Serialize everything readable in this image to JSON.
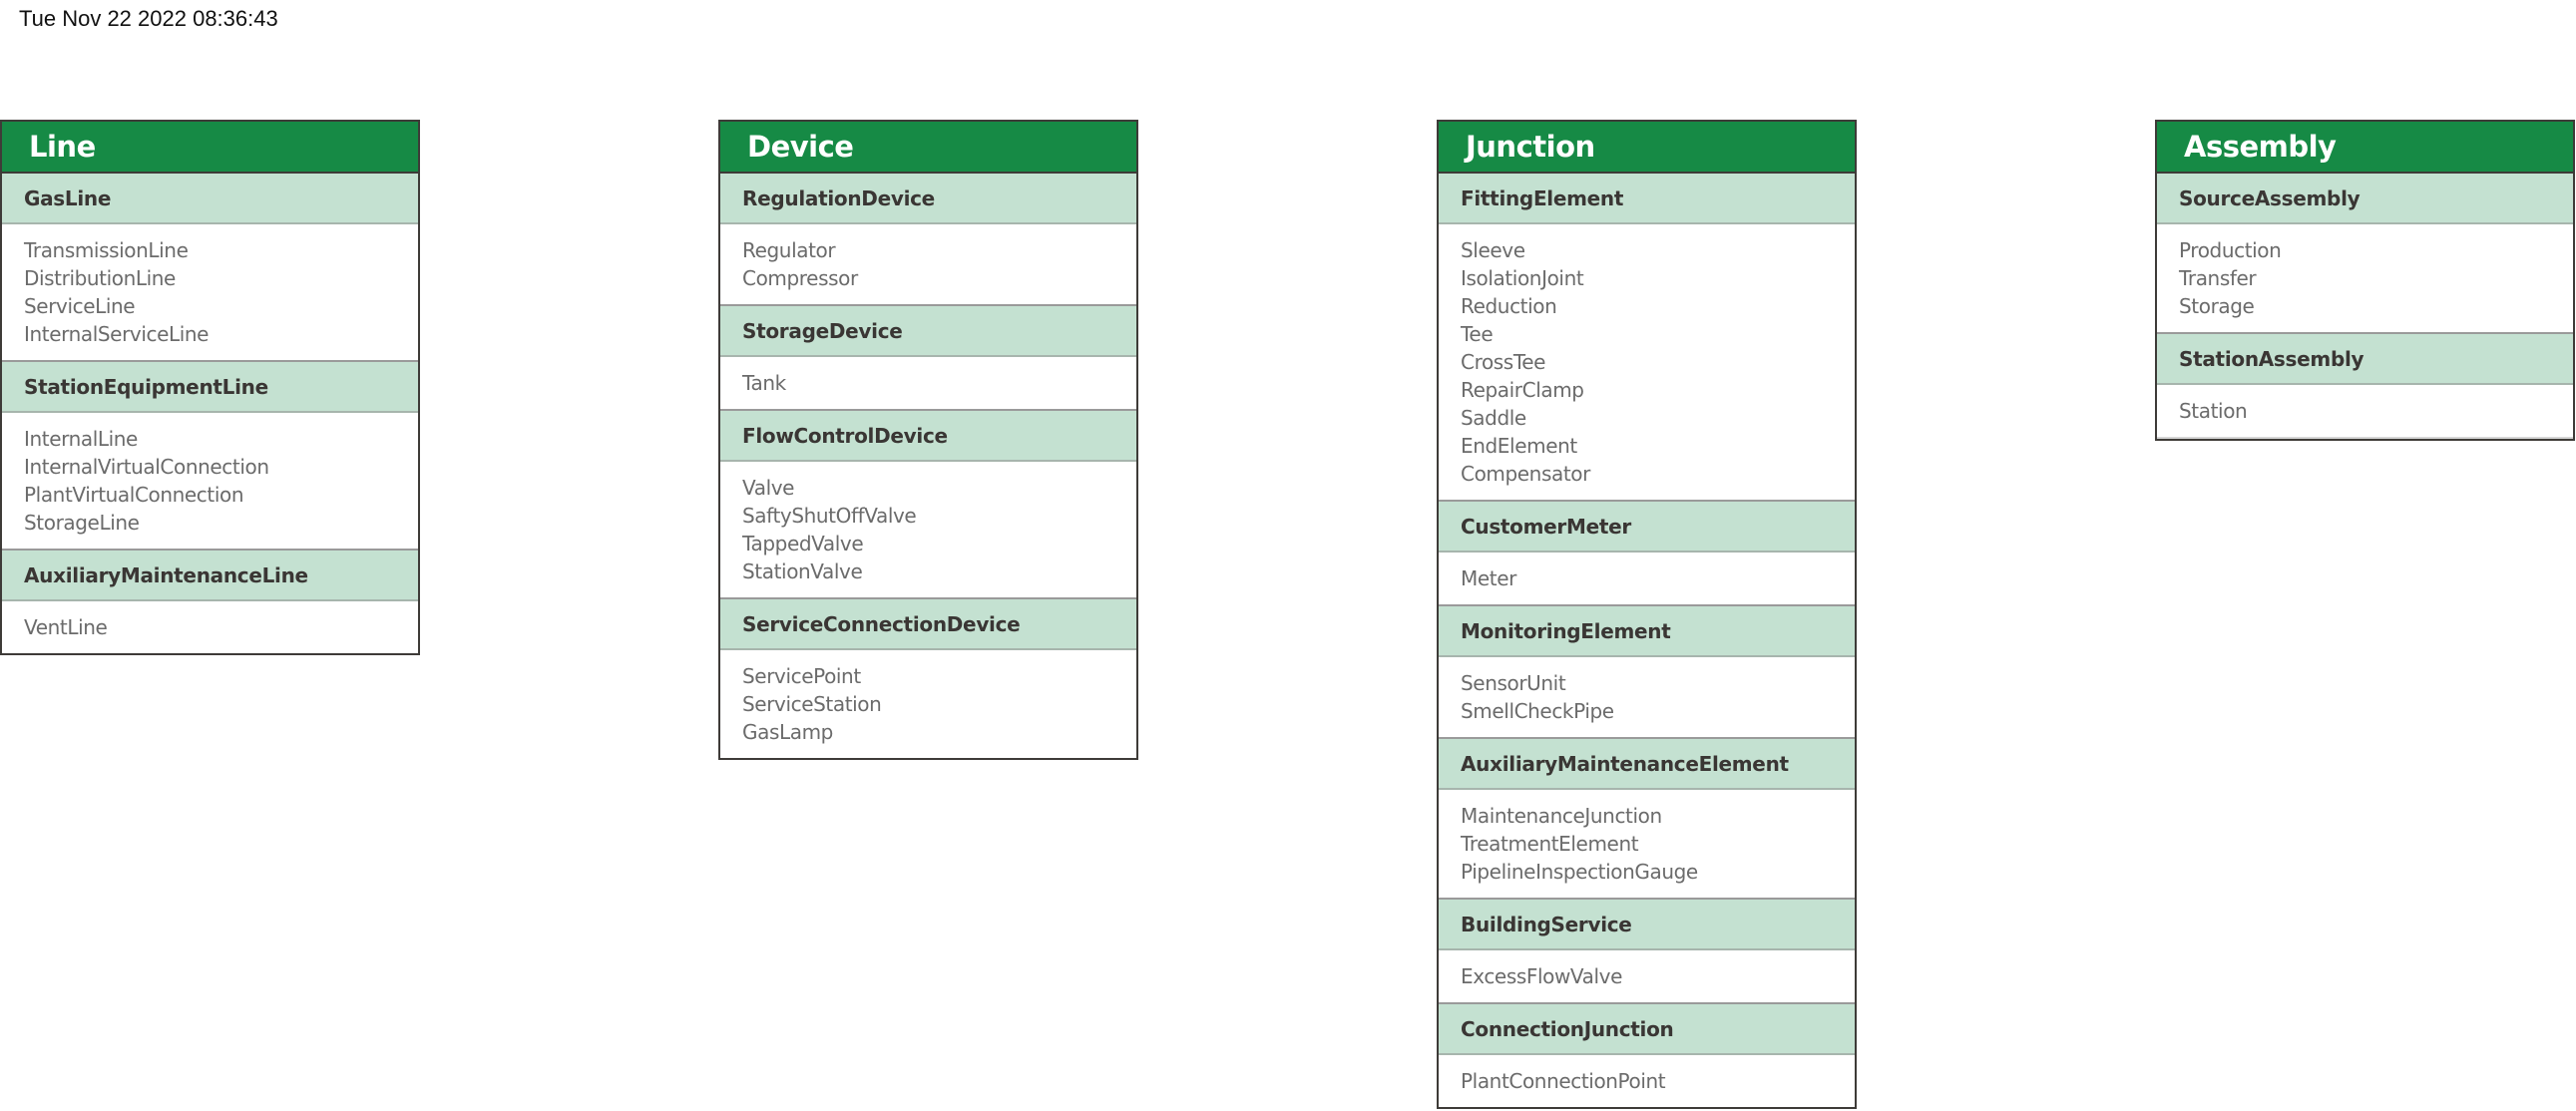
{
  "timestamp": "Tue Nov 22 2022 08:36:43",
  "colors": {
    "group_header_bg": "#168a45",
    "subgroup_header_bg": "#c4e1d1",
    "border": "#3e3b38"
  },
  "groups": [
    {
      "title": "Line",
      "subgroups": [
        {
          "title": "GasLine",
          "items": [
            "TransmissionLine",
            "DistributionLine",
            "ServiceLine",
            "InternalServiceLine"
          ]
        },
        {
          "title": "StationEquipmentLine",
          "items": [
            "InternalLine",
            "InternalVirtualConnection",
            "PlantVirtualConnection",
            "StorageLine"
          ]
        },
        {
          "title": "AuxiliaryMaintenanceLine",
          "items": [
            "VentLine"
          ]
        }
      ]
    },
    {
      "title": "Device",
      "subgroups": [
        {
          "title": "RegulationDevice",
          "items": [
            "Regulator",
            "Compressor"
          ]
        },
        {
          "title": "StorageDevice",
          "items": [
            "Tank"
          ]
        },
        {
          "title": "FlowControlDevice",
          "items": [
            "Valve",
            "SaftyShutOffValve",
            "TappedValve",
            "StationValve"
          ]
        },
        {
          "title": "ServiceConnectionDevice",
          "items": [
            "ServicePoint",
            "ServiceStation",
            "GasLamp"
          ]
        }
      ]
    },
    {
      "title": "Junction",
      "subgroups": [
        {
          "title": "FittingElement",
          "items": [
            "Sleeve",
            "IsolationJoint",
            "Reduction",
            "Tee",
            "CrossTee",
            "RepairClamp",
            "Saddle",
            "EndElement",
            "Compensator"
          ]
        },
        {
          "title": "CustomerMeter",
          "items": [
            "Meter"
          ]
        },
        {
          "title": "MonitoringElement",
          "items": [
            "SensorUnit",
            "SmellCheckPipe"
          ]
        },
        {
          "title": "AuxiliaryMaintenanceElement",
          "items": [
            "MaintenanceJunction",
            "TreatmentElement",
            "PipelineInspectionGauge"
          ]
        },
        {
          "title": "BuildingService",
          "items": [
            "ExcessFlowValve"
          ]
        },
        {
          "title": "ConnectionJunction",
          "items": [
            "PlantConnectionPoint"
          ]
        }
      ]
    },
    {
      "title": "Assembly",
      "subgroups": [
        {
          "title": "SourceAssembly",
          "items": [
            "Production",
            "Transfer",
            "Storage"
          ]
        },
        {
          "title": "StationAssembly",
          "items": [
            "Station"
          ]
        }
      ]
    }
  ]
}
